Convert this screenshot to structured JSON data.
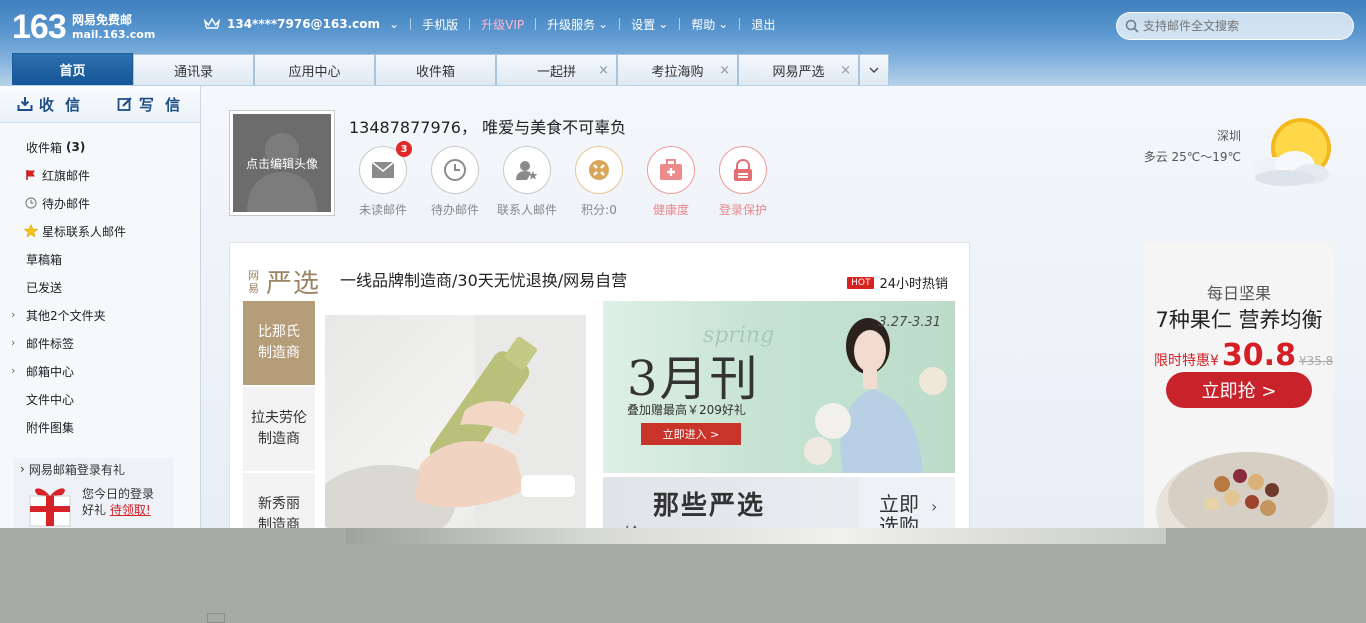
{
  "header": {
    "logo_number": "163",
    "logo_name": "网易免费邮",
    "logo_domain": "mail.163.com",
    "account": "134****7976@163.com",
    "links": [
      "手机版",
      "升级VIP",
      "升级服务",
      "设置",
      "帮助",
      "退出"
    ],
    "search_placeholder": "支持邮件全文搜索"
  },
  "tabs": [
    "首页",
    "通讯录",
    "应用中心",
    "收件箱",
    "一起拼",
    "考拉海购",
    "网易严选"
  ],
  "sidebar": {
    "receive": "收 信",
    "write": "写 信",
    "folders": [
      {
        "label": "收件箱",
        "count": "(3)"
      },
      {
        "label": "红旗邮件",
        "icon": "red-flag-icon"
      },
      {
        "label": "待办邮件",
        "icon": "clock-icon"
      },
      {
        "label": "星标联系人邮件",
        "icon": "star-icon"
      },
      {
        "label": "草稿箱"
      },
      {
        "label": "已发送"
      },
      {
        "label": "其他2个文件夹"
      },
      {
        "label": "邮件标签"
      },
      {
        "label": "邮箱中心"
      },
      {
        "label": "文件中心"
      },
      {
        "label": "附件图集"
      }
    ],
    "promo_title": "网易邮箱登录有礼",
    "promo_line1": "您今日的登录",
    "promo_line2a": "好礼",
    "promo_line2b": "待领取!"
  },
  "profile": {
    "avatar_label": "点击编辑头像",
    "greeting": "13487877976， 唯爱与美食不可辜负",
    "stats": [
      {
        "label": "未读邮件",
        "badge": "3",
        "icon": "envelope-icon"
      },
      {
        "label": "待办邮件",
        "icon": "clock-icon"
      },
      {
        "label": "联系人邮件",
        "icon": "contact-star-icon"
      },
      {
        "label": "积分:0",
        "icon": "points-icon"
      },
      {
        "label": "健康度",
        "icon": "health-kit-icon"
      },
      {
        "label": "登录保护",
        "icon": "lock-icon"
      }
    ]
  },
  "weather": {
    "city": "深圳",
    "desc": "多云 25℃～19℃"
  },
  "yanxuan": {
    "logo_small": "网易",
    "logo_big": "严选",
    "slogan": "一线品牌制造商/30天无忧退换/网易自营",
    "hot_badge": "HOT",
    "hot_text": "24小时热销",
    "vendors": [
      "比那氏\n制造商",
      "拉夫劳伦\n制造商",
      "新秀丽\n制造商"
    ],
    "banner1_date": "3.27-3.31",
    "banner1_spring": "spring",
    "banner1_title": "3月刊",
    "banner1_sub": "叠加赠最高￥209好礼",
    "banner1_btn": "立即进入 >",
    "banner2_title": "那些严选",
    "banner2_buy": "立即\n选购",
    "banner2_sub": "给"
  },
  "ad": {
    "line1": "每日坚果",
    "line2": "7种果仁 营养均衡",
    "price_label": "限时特惠¥",
    "price": "30.8",
    "old_price": "¥35.8",
    "button": "立即抢 >"
  },
  "colors": {
    "accent": "#145696",
    "red": "#d41f27",
    "gold": "#b49d78"
  }
}
